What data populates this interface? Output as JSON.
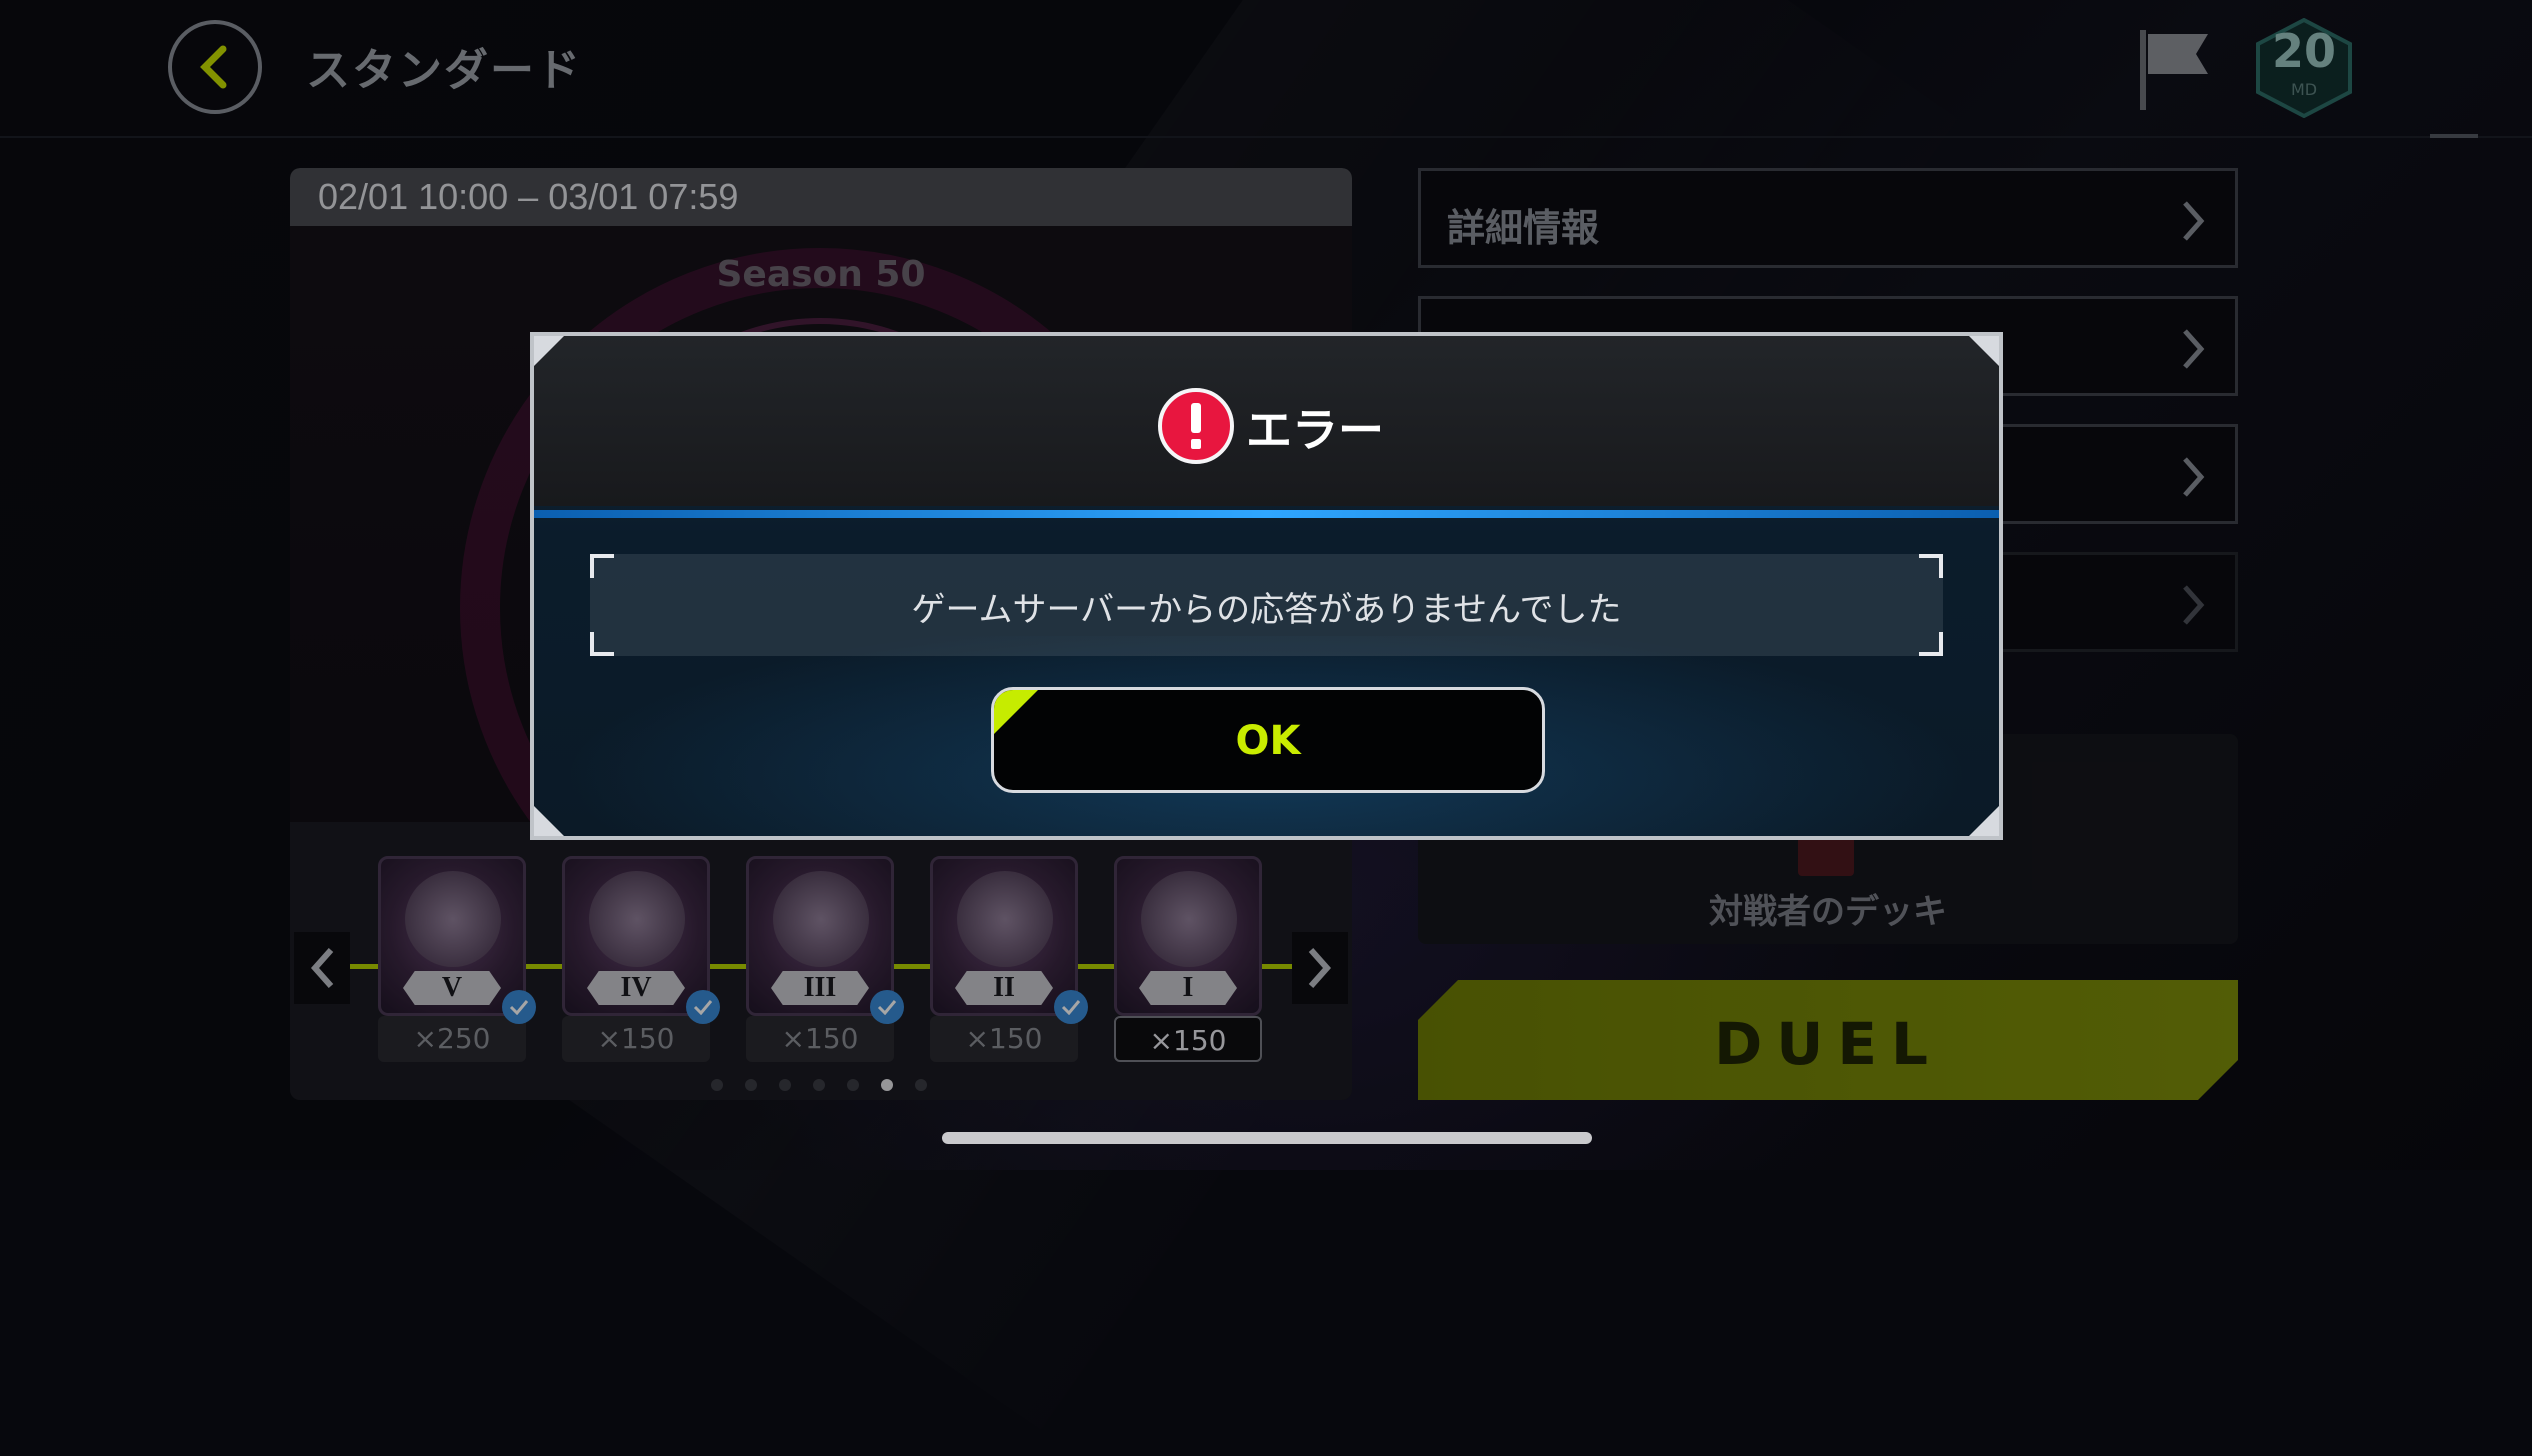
{
  "header": {
    "title": "スタンダード",
    "md_level": "20",
    "md_label": "MD"
  },
  "season": {
    "date_range": "02/01 10:00 – 03/01 07:59",
    "label": "Season 50",
    "ranks": [
      {
        "numeral": "V",
        "reward": "×250",
        "claimed": true
      },
      {
        "numeral": "IV",
        "reward": "×150",
        "claimed": true
      },
      {
        "numeral": "III",
        "reward": "×150",
        "claimed": true
      },
      {
        "numeral": "II",
        "reward": "×150",
        "claimed": true
      },
      {
        "numeral": "I",
        "reward": "×150",
        "claimed": false
      }
    ],
    "page_count": 7,
    "current_page": 6
  },
  "menu": {
    "details_label": "詳細情報"
  },
  "opponent": {
    "label": "対戦者のデッキ"
  },
  "duel": {
    "label": "DUEL"
  },
  "dialog": {
    "title": "エラー",
    "message": "ゲームサーバーからの応答がありませんでした",
    "ok_label": "OK"
  },
  "colors": {
    "accent": "#c9ec00",
    "error": "#e8163f",
    "blue": "#2fa6ff"
  }
}
